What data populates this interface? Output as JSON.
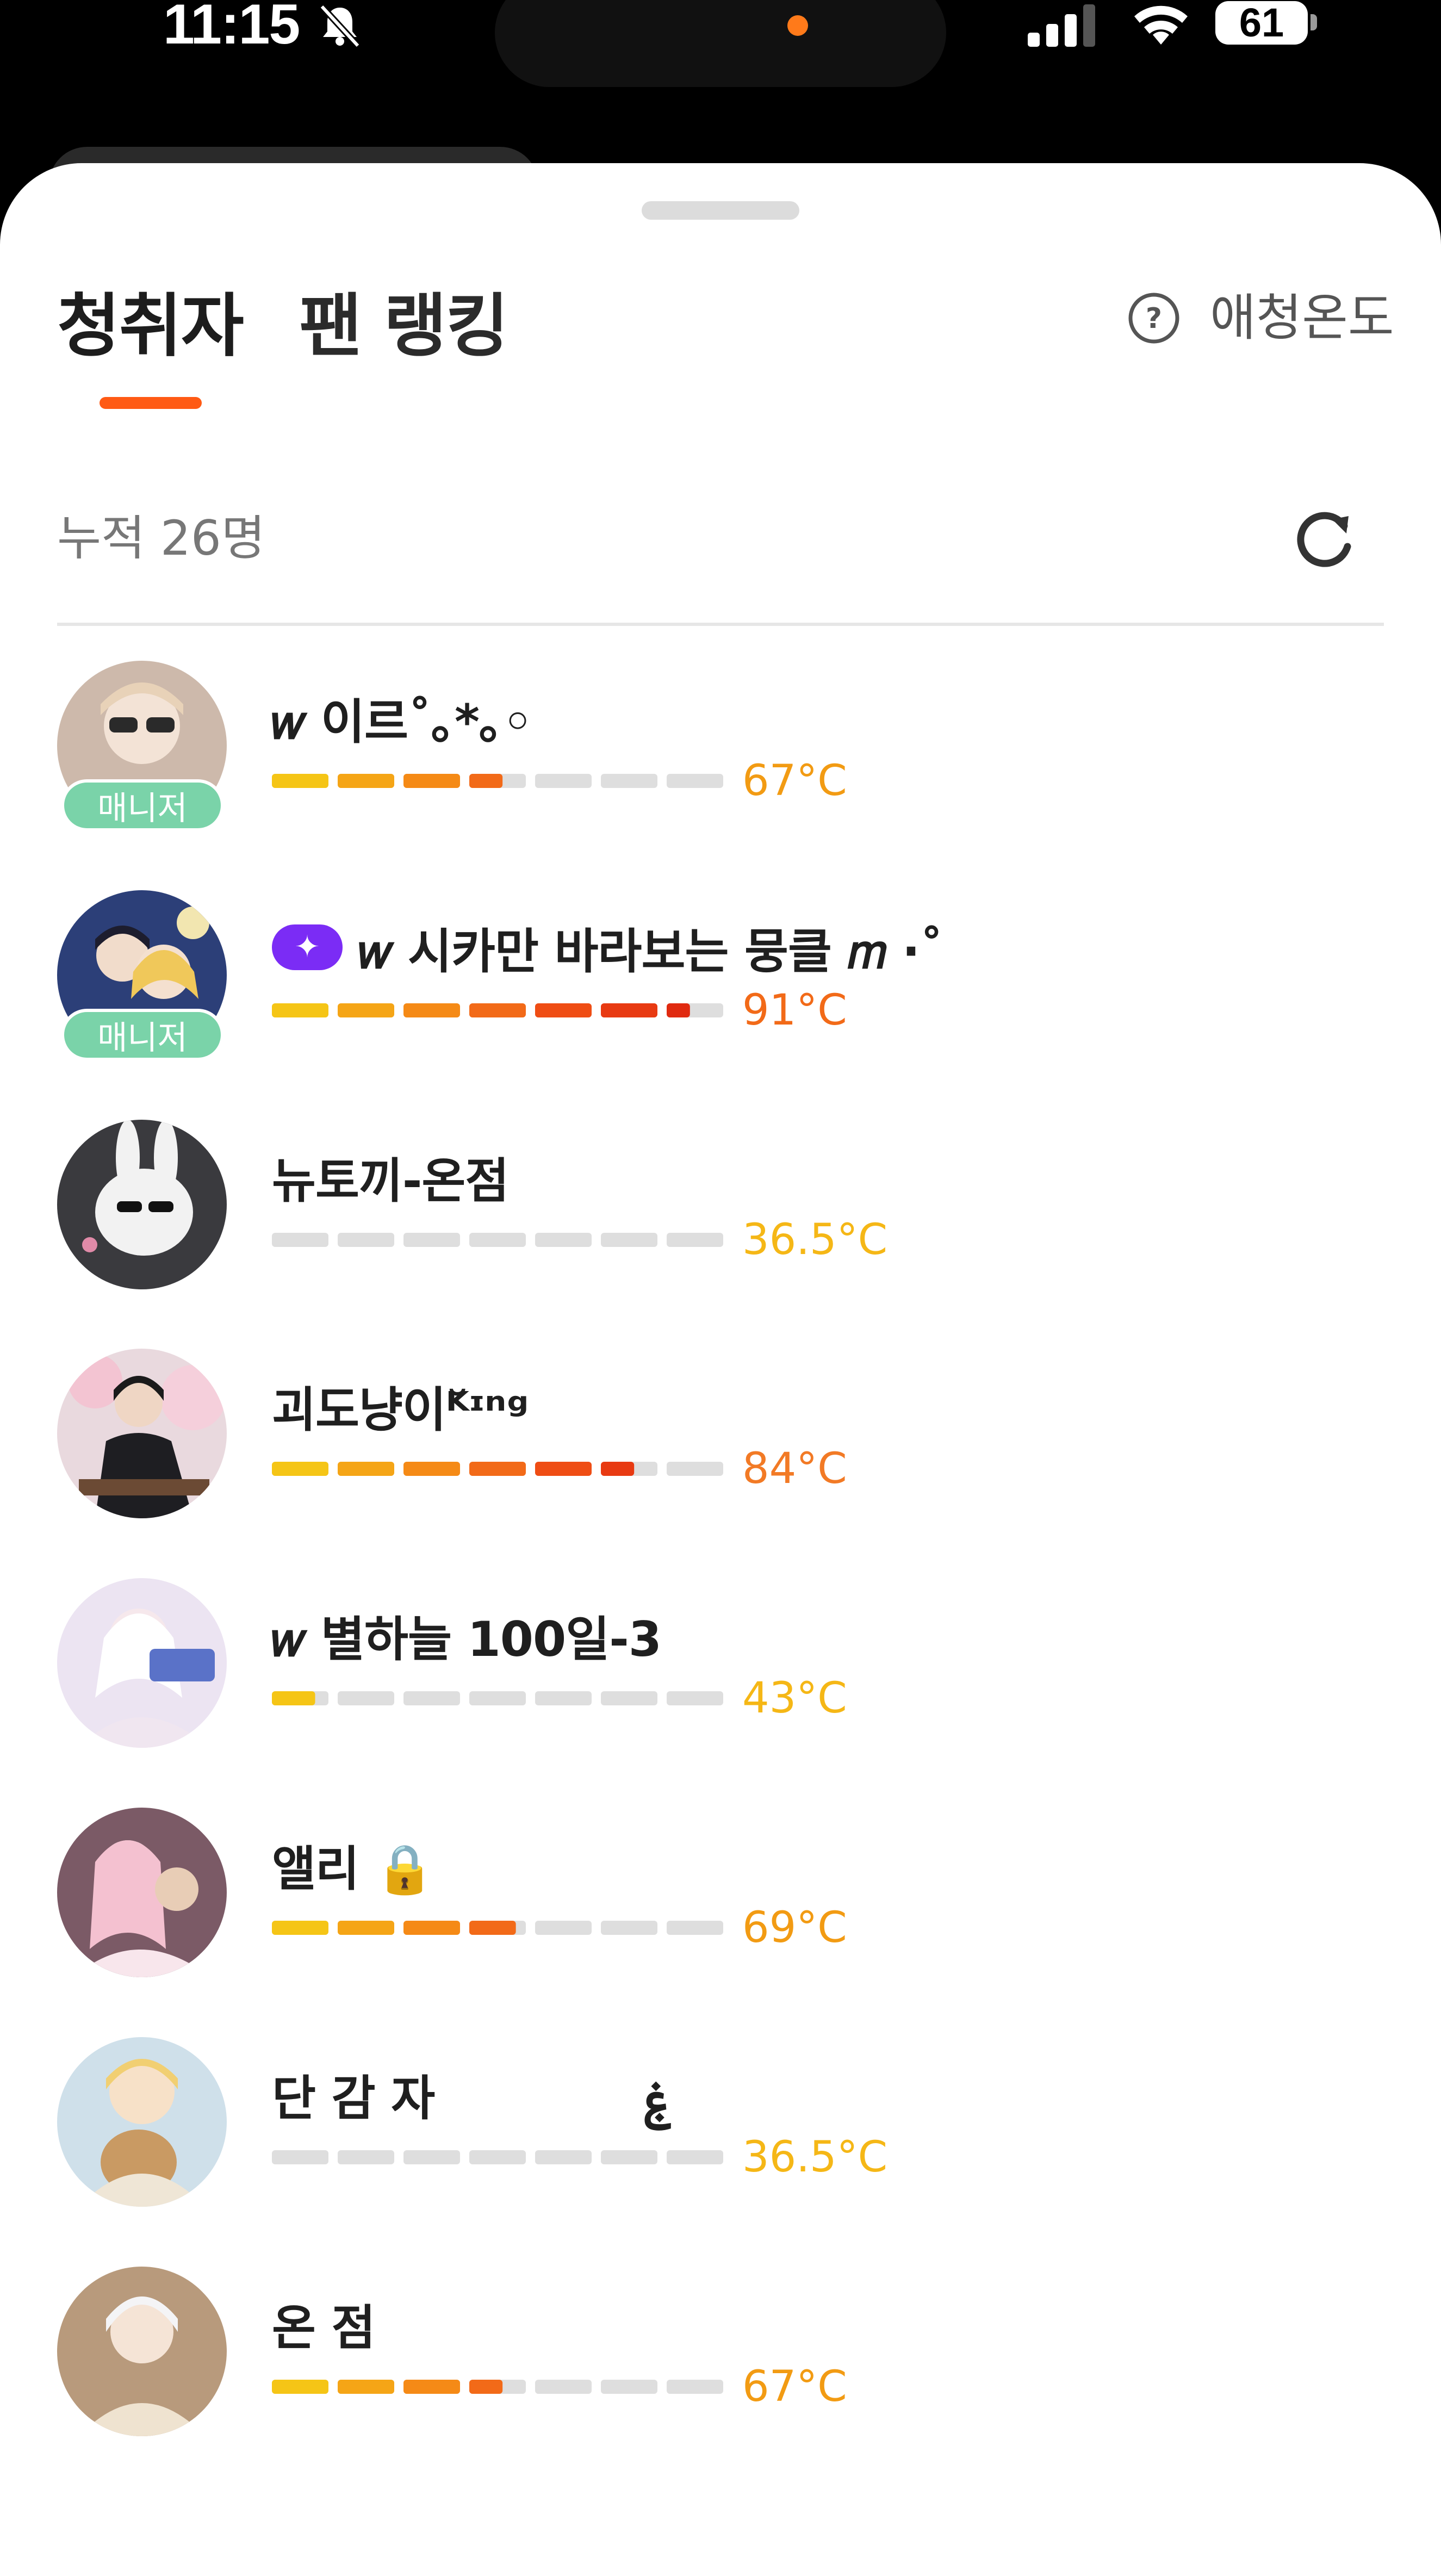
{
  "status_bar": {
    "time": "11:15",
    "battery": "61"
  },
  "tabs": [
    {
      "label": "청취자",
      "selected": true
    },
    {
      "label": "팬 랭킹",
      "selected": false
    }
  ],
  "help": {
    "label": "애청온도"
  },
  "summary": {
    "cumulative": "누적 26명"
  },
  "colors": {
    "accent": "#ff5a14",
    "manager_badge": "#7ad3a9",
    "vip_badge": "#7b2cf5",
    "bar_empty": "#dedede"
  },
  "listeners": [
    {
      "nickname": "𝑤 이르˚｡*｡◦",
      "temperature": "67°C",
      "level": 67,
      "badge": "매니저",
      "temp_color": "#f29b13",
      "avatar_icon": "avatar-icon"
    },
    {
      "nickname": "𝑤 시카만 바라보는 뭉클 𝑚 ·˚",
      "temperature": "91°C",
      "level": 91,
      "badge": "매니저",
      "vip": "✦",
      "temp_color": "#f26a18",
      "avatar_icon": "avatar-icon"
    },
    {
      "nickname": "뉴토끼-온점",
      "temperature": "36.5°C",
      "level": 36.5,
      "temp_color": "#f5b716",
      "avatar_icon": "avatar-icon"
    },
    {
      "nickname": "괴도냥이ᴷ̆ᶦⁿᵍ",
      "temperature": "84°C",
      "level": 84,
      "temp_color": "#f27a25",
      "avatar_icon": "avatar-icon"
    },
    {
      "nickname": "𝑤 별하늘 100일-3",
      "temperature": "43°C",
      "level": 43,
      "temp_color": "#f5b716",
      "avatar_icon": "avatar-icon"
    },
    {
      "nickname": "앨리 🔒",
      "temperature": "69°C",
      "level": 69,
      "temp_color": "#f29b13",
      "avatar_icon": "avatar-icon"
    },
    {
      "nickname": "단 감 자             ۼ",
      "temperature": "36.5°C",
      "level": 36.5,
      "temp_color": "#f5b716",
      "avatar_icon": "avatar-icon"
    },
    {
      "nickname": "온 점",
      "temperature": "67°C",
      "level": 67,
      "temp_color": "#f29b13",
      "avatar_icon": "avatar-icon"
    }
  ]
}
